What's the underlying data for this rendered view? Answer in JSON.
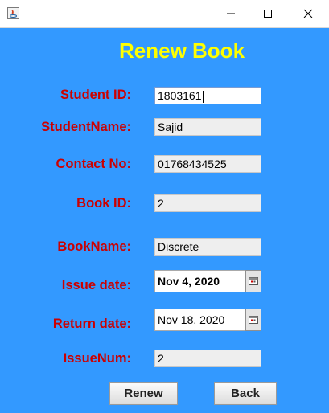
{
  "window": {
    "icon": "java-app-icon",
    "controls": {
      "minimize": "minimize-icon",
      "maximize": "maximize-icon",
      "close": "close-icon"
    }
  },
  "form": {
    "title": "Renew Book",
    "student_id": {
      "label": "Student ID:",
      "value": "1803161"
    },
    "student_name": {
      "label": "StudentName:",
      "value": "Sajid"
    },
    "contact_no": {
      "label": "Contact No:",
      "value": "01768434525"
    },
    "book_id": {
      "label": "Book ID:",
      "value": "2"
    },
    "book_name": {
      "label": "BookName:",
      "value": "Discrete"
    },
    "issue_date": {
      "label": "Issue date:",
      "value": "Nov 4, 2020",
      "picker_icon": "calendar-icon"
    },
    "return_date": {
      "label": "Return date:",
      "value": "Nov 18, 2020",
      "picker_icon": "calendar-icon"
    },
    "issue_num": {
      "label": "IssueNum:",
      "value": "2"
    }
  },
  "buttons": {
    "renew": "Renew",
    "back": "Back"
  },
  "colors": {
    "background": "#3399ff",
    "title": "#ffff00",
    "labels": "#cc0000"
  }
}
